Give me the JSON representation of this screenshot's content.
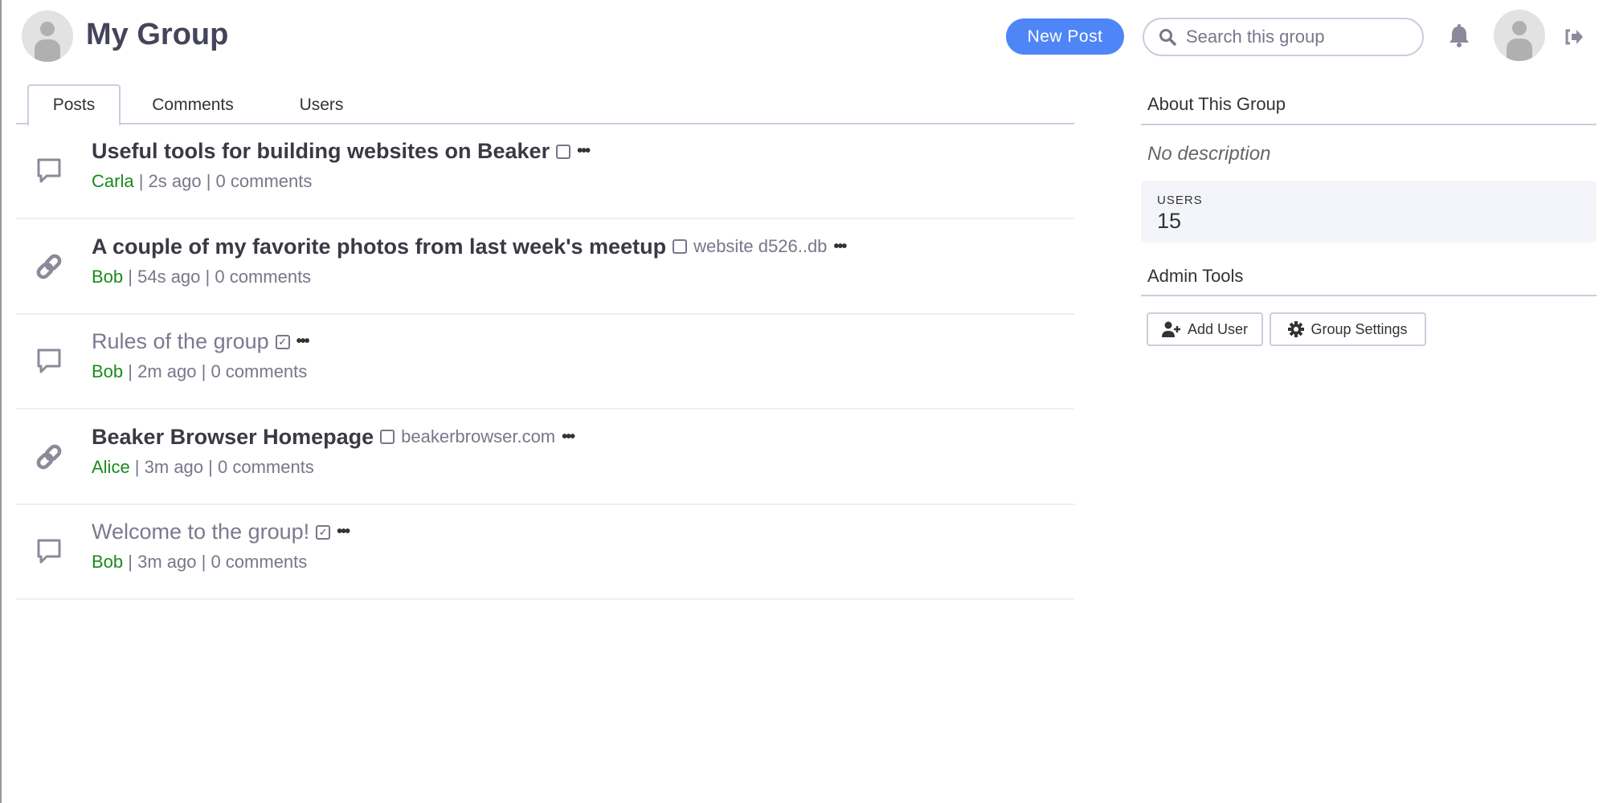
{
  "header": {
    "title": "My Group",
    "new_post": "New Post",
    "search_placeholder": "Search this group"
  },
  "tabs": [
    {
      "label": "Posts",
      "active": true
    },
    {
      "label": "Comments"
    },
    {
      "label": "Users"
    }
  ],
  "posts": [
    {
      "title": "Useful tools for building websites on Beaker",
      "type": "text",
      "read": false,
      "domain": "",
      "author": "Carla",
      "time": "2s ago",
      "comments": "0 comments"
    },
    {
      "title": "A couple of my favorite photos from last week's meetup",
      "type": "link",
      "read": false,
      "domain": "website d526..db",
      "author": "Bob",
      "time": "54s ago",
      "comments": "0 comments"
    },
    {
      "title": "Rules of the group",
      "type": "text",
      "read": true,
      "domain": "",
      "author": "Bob",
      "time": "2m ago",
      "comments": "0 comments"
    },
    {
      "title": "Beaker Browser Homepage",
      "type": "link",
      "read": false,
      "domain": "beakerbrowser.com",
      "author": "Alice",
      "time": "3m ago",
      "comments": "0 comments"
    },
    {
      "title": "Welcome to the group!",
      "type": "text",
      "read": true,
      "domain": "",
      "author": "Bob",
      "time": "3m ago",
      "comments": "0 comments"
    }
  ],
  "sidebar": {
    "about_title": "About This Group",
    "description": "No description",
    "users_label": "USERS",
    "users_count": "15",
    "admin_title": "Admin Tools",
    "add_user": "Add User",
    "group_settings": "Group Settings"
  },
  "colors": {
    "accent": "#4f86f7",
    "author": "#1a8a1a"
  }
}
